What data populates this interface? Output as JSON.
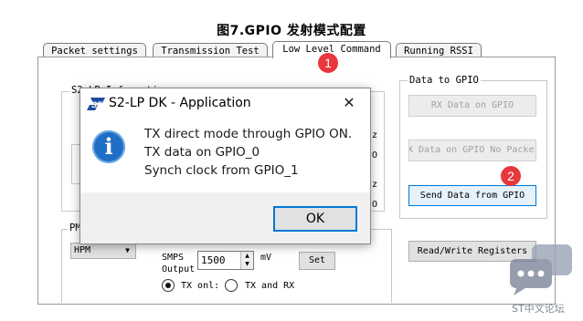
{
  "caption": "图7.GPIO 发射模式配置",
  "tabs": [
    {
      "label": "Packet settings"
    },
    {
      "label": "Transmission Test"
    },
    {
      "label": "Low Level Command"
    },
    {
      "label": "Running RSSI"
    }
  ],
  "markers": [
    "1",
    "2"
  ],
  "groups": {
    "s2": "S2-LP Information",
    "pm": "PM",
    "data_to_gpio": "Data to GPIO"
  },
  "bg_fragments": [
    "z",
    "O",
    "z",
    "O"
  ],
  "buttons": {
    "rx_data_on_gpio": "RX Data on GPIO",
    "rx_data_no_packet": "X Data on GPIO No Packe",
    "send_data_from_gpio": "Send Data from GPIO",
    "read_write_registers": "Read/Write Registers",
    "set": "Set"
  },
  "pm": {
    "mode_value": "HPM",
    "smps_label_1": "SMPS",
    "smps_label_2": "Output",
    "smps_value": "1500",
    "unit": "mV",
    "radio_tx_only": "TX onl:",
    "radio_tx_rx": "TX and RX"
  },
  "dialog": {
    "title": "S2-LP DK - Application",
    "lines": [
      "TX direct mode through GPIO ON.",
      "TX data on GPIO_0",
      "Synch clock from GPIO_1"
    ],
    "ok": "OK",
    "close_glyph": "✕",
    "info_glyph": "i"
  },
  "watermark": "ST中文论坛",
  "colors": {
    "marker": "#e8373d",
    "focus": "#0078d7",
    "info_icon": "#1f6fc6"
  }
}
